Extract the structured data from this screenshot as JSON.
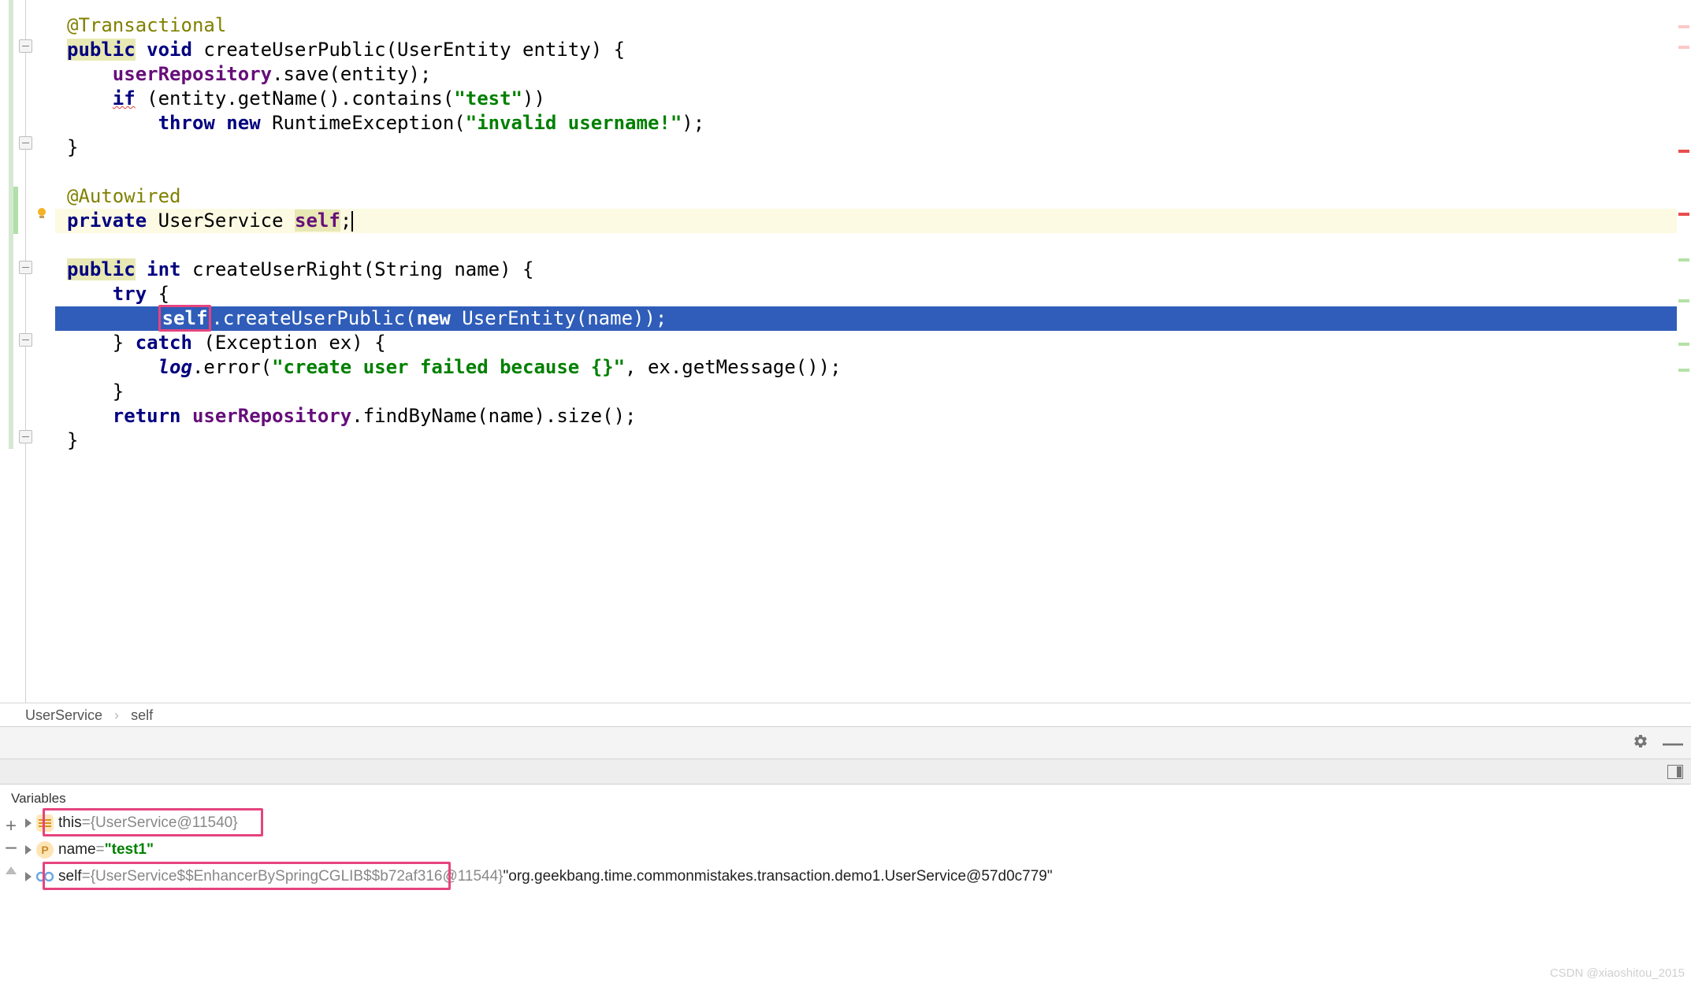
{
  "code": {
    "annotation_transactional": "@Transactional",
    "kw_public": "public",
    "kw_void": "void",
    "m_createUserPublic": "createUserPublic",
    "t_UserEntity": "UserEntity",
    "p_entity": "entity",
    "f_userRepository": "userRepository",
    "c_save": ".save(entity);",
    "kw_if": "if",
    "c_getName": "(entity.getName().contains(",
    "s_test": "\"test\"",
    "c_getName_end": "))",
    "kw_throw": "throw",
    "kw_new": "new",
    "t_RuntimeException": "RuntimeException(",
    "s_invalid": "\"invalid username!\"",
    "t_RuntimeException_end": ");",
    "annotation_autowired": "@Autowired",
    "kw_private": "private",
    "t_UserService": "UserService",
    "f_self": "self",
    "kw_int": "int",
    "m_createUserRight": "createUserRight",
    "t_String": "String",
    "p_name": "name",
    "kw_try": "try",
    "hl_self": "self",
    "c_createUserPublic_call": ".createUserPublic(",
    "c_createUserPublic_end": " UserEntity(name));",
    "kw_catch": "catch",
    "t_Exception": "(Exception ex) {",
    "f_log": "log",
    "c_error": ".error(",
    "s_fail": "\"create user failed because {}\"",
    "c_error_end": ", ex.getMessage());",
    "kw_return": "return",
    "c_findByName": ".findByName(name).size();"
  },
  "breadcrumb": {
    "class": "UserService",
    "field": "self"
  },
  "vars_title": "Variables",
  "variables": {
    "this": {
      "name": "this",
      "eq": " = ",
      "val": "{UserService@11540}"
    },
    "name": {
      "name": "name",
      "eq": " = ",
      "val": "\"test1\""
    },
    "self": {
      "name": "self",
      "eq": " = ",
      "val1": "{UserService$$EnhancerBySpringCGLIB$$b72af316@11544}",
      "val2": " \"org.geekbang.time.commonmistakes.transaction.demo1.UserService@57d0c779\""
    }
  },
  "watermark": "CSDN @xiaoshitou_2015",
  "icons": {
    "toggle": "≡",
    "p": "P"
  }
}
